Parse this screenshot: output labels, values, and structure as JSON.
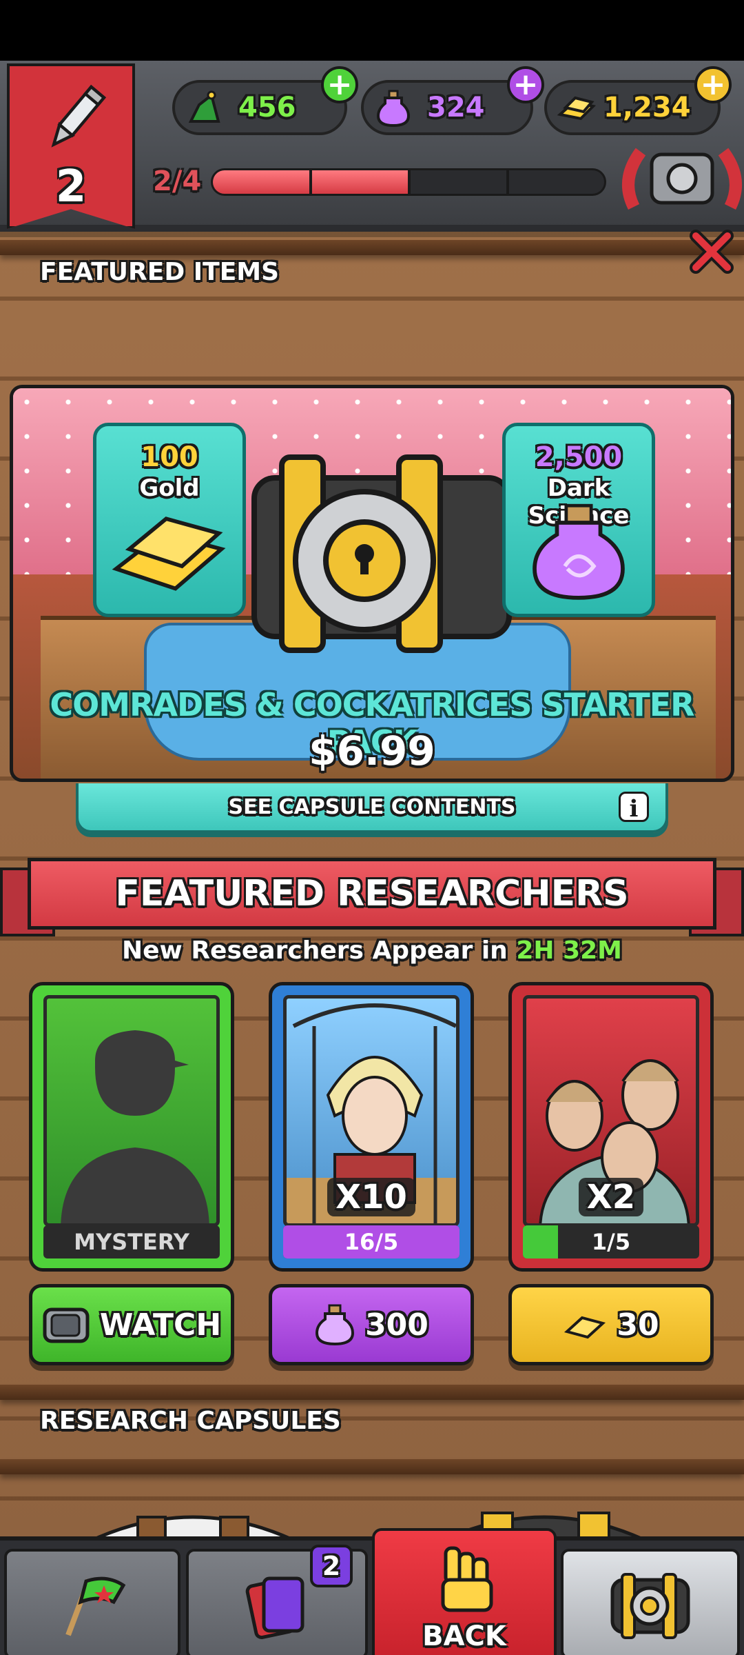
{
  "hud": {
    "rank": "2",
    "xp_text": "2/4",
    "xp_progress": 0.5,
    "currencies": [
      {
        "name": "wizard-hat-currency",
        "value": "456",
        "plus_color": "#4fd23a"
      },
      {
        "name": "dark-science",
        "value": "324",
        "plus_color": "#b04ee6"
      },
      {
        "name": "gold",
        "value": "1,234",
        "plus_color": "#f2c230"
      }
    ],
    "plus_label": "+",
    "close_icon": "close-x-icon"
  },
  "featured_items": {
    "title": "FEATURED ITEMS",
    "pack": {
      "gold_amount": "100",
      "gold_label": "Gold",
      "science_amount": "2,500",
      "science_label": "Dark Science",
      "title": "COMRADES & COCKATRICES STARTER PACK",
      "price": "$6.99",
      "capsule_button": "SEE CAPSULE CONTENTS",
      "info": "i"
    }
  },
  "featured_researchers": {
    "title": "FEATURED RESEARCHERS",
    "timer_prefix": "New Researchers Appear in",
    "timer_value": "2H 32M",
    "cards": [
      {
        "label": "MYSTERY",
        "color": "#4fd23a",
        "button": "WATCH",
        "button_icon": "tv-icon",
        "button_color": "#4fd23a"
      },
      {
        "multiplier": "X10",
        "progress_text": "16/5",
        "progress": 1.0,
        "progress_color": "#b04ee6",
        "color": "#2f7fd6",
        "button": "300",
        "button_icon": "dark-science-icon",
        "button_color": "#b04ee6"
      },
      {
        "multiplier": "X2",
        "progress_text": "1/5",
        "progress": 0.2,
        "progress_color": "#45c93a",
        "color": "#cc3038",
        "button": "30",
        "button_icon": "gold-bar-icon",
        "button_color": "#f2c230"
      }
    ]
  },
  "research_capsules": {
    "title": "RESEARCH CAPSULES"
  },
  "bottom_nav": {
    "tabs": [
      {
        "name": "missions",
        "icon": "flag-icon"
      },
      {
        "name": "cards",
        "icon": "cards-icon",
        "badge": "2"
      },
      {
        "name": "back",
        "icon": "fist-icon",
        "label": "BACK"
      },
      {
        "name": "shop",
        "icon": "vault-icon"
      }
    ]
  }
}
